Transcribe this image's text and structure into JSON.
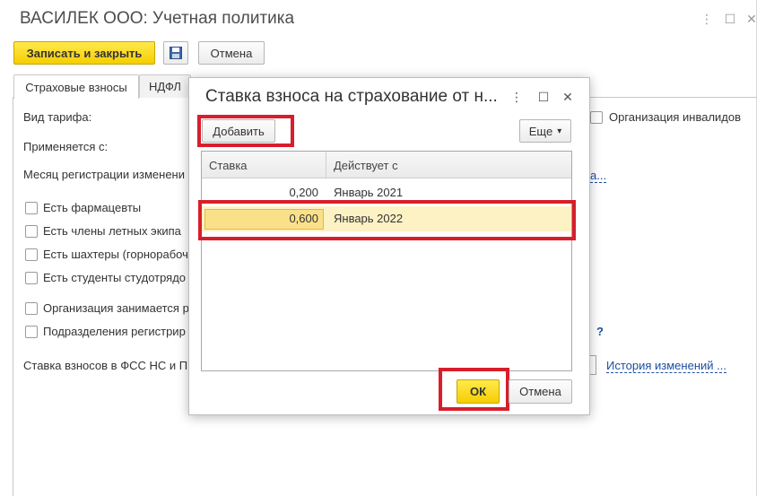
{
  "window": {
    "title": "ВАСИЛЕК ООО: Учетная политика",
    "menu_icon": "⋮",
    "maximize_icon": "☐",
    "close_icon": "✕"
  },
  "toolbar": {
    "save_close_label": "Записать и закрыть",
    "save_icon": "floppy-disk",
    "cancel_label": "Отмена"
  },
  "tabs": [
    {
      "label": "Страховые взносы",
      "active": true
    },
    {
      "label": "НДФЛ",
      "active": false
    }
  ],
  "form": {
    "tariff_label": "Вид тарифа:",
    "applies_label": "Применяется с:",
    "reg_month_label": "Месяц регистрации изменени",
    "disabled_org_label": "Организация инвалидов",
    "hist_link_partial": "а...",
    "checkboxes": [
      {
        "label": "Есть фармацевты"
      },
      {
        "label": "Есть члены летных экипа"
      },
      {
        "label": "Есть шахтеры (горнорабоч"
      },
      {
        "label": "Есть студенты студотрядо"
      }
    ],
    "checkboxes2": [
      {
        "label": "Организация занимается р"
      },
      {
        "label": "Подразделения регистрир"
      }
    ],
    "help_mark": "?",
    "fss_rate_label": "Ставка взносов в ФСС НС и П",
    "history_link": "История изменений ..."
  },
  "dialog": {
    "title": "Ставка взноса на страхование от н...",
    "menu_icon": "⋮",
    "maximize_icon": "☐",
    "close_icon": "✕",
    "add_label": "Добавить",
    "more_label": "Еще",
    "more_arrow": "▾",
    "columns": [
      "Ставка",
      "Действует с"
    ],
    "rows": [
      {
        "rate": "0,200",
        "from": "Январь 2021",
        "selected": false
      },
      {
        "rate": "0,600",
        "from": "Январь 2022",
        "selected": true
      }
    ],
    "ok_label": "ОК",
    "cancel_label": "Отмена"
  },
  "colors": {
    "accent_yellow": "#f5ce00",
    "highlight_red": "#d81e2b",
    "selected_row": "#fdf2c4",
    "selected_cell": "#fbe08a",
    "link": "#1c4fa0"
  }
}
